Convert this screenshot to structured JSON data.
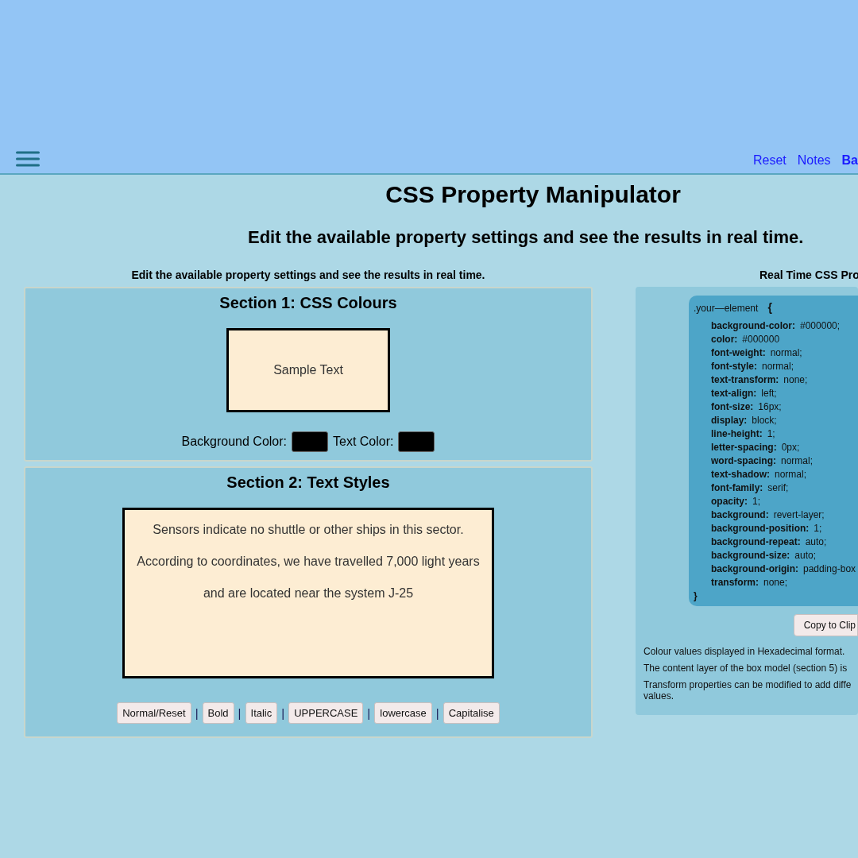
{
  "nav": {
    "links": [
      {
        "label": "Reset",
        "bold": false
      },
      {
        "label": "Notes",
        "bold": false
      },
      {
        "label": "Ba",
        "bold": true
      }
    ]
  },
  "title": "CSS Property Manipulator",
  "subtitle": "Edit the available property settings and see the results in real time.",
  "left": {
    "heading": "Edit the available property settings and see the results in real time.",
    "section1": {
      "title": "Section 1: CSS Colours",
      "sample": "Sample Text",
      "controls": [
        {
          "label": "Background Color:",
          "color": "#000000"
        },
        {
          "label": "Text Color:",
          "color": "#000000"
        }
      ]
    },
    "section2": {
      "title": "Section 2: Text Styles",
      "lines": [
        "Sensors indicate no shuttle or other ships in this sector.",
        "According to coordinates, we have travelled 7,000 light years",
        "and are located near the system J-25"
      ],
      "buttons": [
        {
          "label": "Normal/Reset"
        },
        {
          "label": "Bold",
          "separator_before": "|"
        },
        {
          "label": "Italic",
          "separator_before": "|"
        },
        {
          "label": "UPPERCASE",
          "separator_before": "|"
        },
        {
          "label": "lowercase",
          "separator_before": "|"
        },
        {
          "label": "Capitalise",
          "separator_before": "|"
        }
      ]
    }
  },
  "right": {
    "heading": "Real Time CSS Pro",
    "selector": ".your—element",
    "open": "{",
    "close": "}",
    "properties": [
      {
        "name": "background-color:",
        "value": "#000000;"
      },
      {
        "name": "color:",
        "value": "#000000"
      },
      {
        "name": "font-weight:",
        "value": "normal;"
      },
      {
        "name": "font-style:",
        "value": "normal;"
      },
      {
        "name": "text-transform:",
        "value": "none;"
      },
      {
        "name": "text-align:",
        "value": "left;"
      },
      {
        "name": "font-size:",
        "value": "16px;"
      },
      {
        "name": "display:",
        "value": "block;"
      },
      {
        "name": "line-height:",
        "value": "1;"
      },
      {
        "name": "letter-spacing:",
        "value": "0px;"
      },
      {
        "name": "word-spacing:",
        "value": "normal;"
      },
      {
        "name": "text-shadow:",
        "value": "normal;"
      },
      {
        "name": "font-family:",
        "value": "serif;"
      },
      {
        "name": "opacity:",
        "value": "1;"
      },
      {
        "name": "background:",
        "value": "revert-layer;"
      },
      {
        "name": "background-position:",
        "value": "1;"
      },
      {
        "name": "background-repeat:",
        "value": "auto;"
      },
      {
        "name": "background-size:",
        "value": "auto;"
      },
      {
        "name": "background-origin:",
        "value": "padding-box"
      },
      {
        "name": "transform:",
        "value": "none;"
      }
    ],
    "copy_button": "Copy to Clip",
    "notes": [
      "Colour values displayed in Hexadecimal format.",
      "The content layer of the box model (section 5) is",
      "Transform properties can be modified to add diffe values."
    ]
  }
}
